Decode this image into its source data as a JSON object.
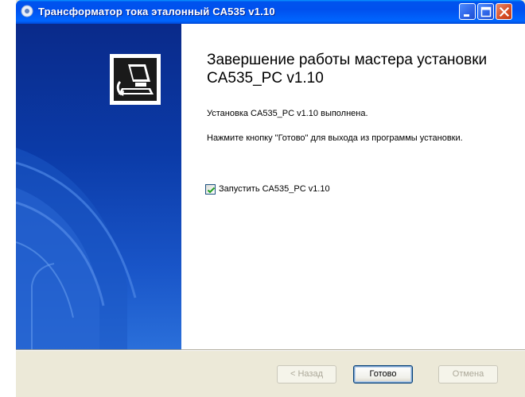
{
  "window": {
    "title": "Трансформатор тока эталонный СА535 v1.10"
  },
  "main": {
    "heading": "Завершение работы мастера установки CA535_PC v1.10",
    "status_text": "Установка CA535_PC v1.10 выполнена.",
    "instruction_text": "Нажмите кнопку \"Готово\" для выхода из программы установки.",
    "launch_checkbox": {
      "label": "Запустить CA535_PC v1.10",
      "checked": true
    }
  },
  "buttons": {
    "back_label": "< Назад",
    "finish_label": "Готово",
    "cancel_label": "Отмена"
  },
  "colors": {
    "titlebar": "#0050ee",
    "side_panel": "#0b3ba8",
    "dialog_bg": "#ece9d8",
    "close_button": "#d64d25"
  },
  "icons": {
    "title": "installer-icon",
    "product": "computer-install-icon"
  }
}
